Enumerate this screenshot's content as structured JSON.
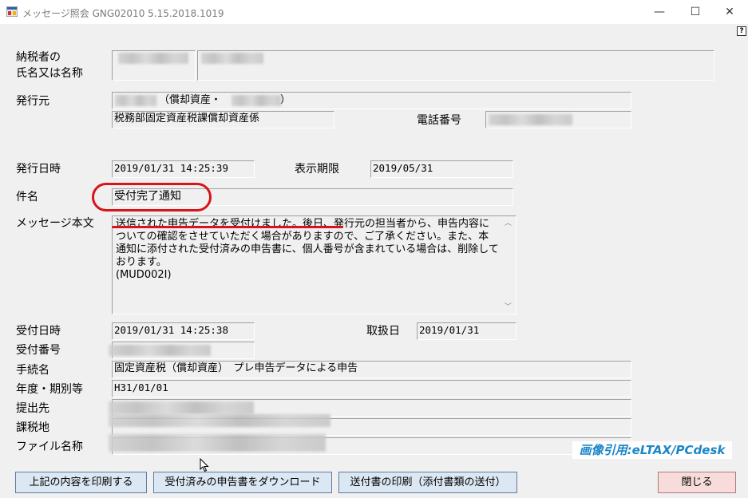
{
  "window": {
    "title": "メッセージ照会 GNG02010  5.15.2018.1019",
    "minimize": "—",
    "maximize": "☐",
    "close": "✕",
    "help": "?"
  },
  "labels": {
    "taxpayer_line1": "納税者の",
    "taxpayer_line2": "氏名又は名称",
    "issuer": "発行元",
    "phone": "電話番号",
    "issue_datetime": "発行日時",
    "display_deadline": "表示期限",
    "subject": "件名",
    "message_body": "メッセージ本文",
    "received_datetime": "受付日時",
    "handled_date": "取扱日",
    "received_number": "受付番号",
    "procedure_name": "手続名",
    "fiscal_period": "年度・期別等",
    "submit_to": "提出先",
    "tax_location": "課税地",
    "file_name": "ファイル名称"
  },
  "fields": {
    "issuer_name_suffix": "（償却資産・",
    "issuer_name_close": "）",
    "issuer_department": "税務部固定資産税課償却資産係",
    "issue_datetime": "2019/01/31 14:25:39",
    "display_deadline": "2019/05/31",
    "subject": "受付完了通知",
    "message_body": "送信された申告データを受付けました。後日、発行元の担当者から、申告内容についての確認をさせていただく場合がありますので、ご了承ください。また、本通知に添付された受付済みの申告書に、個人番号が含まれている場合は、削除しております。\n(MUD002I)",
    "received_datetime": "2019/01/31 14:25:38",
    "handled_date": "2019/01/31",
    "procedure_name": "固定資産税（償却資産）　プレ申告データによる申告",
    "fiscal_period": "H31/01/01"
  },
  "watermark": "画像引用:eLTAX/PCdesk",
  "buttons": {
    "print": "上記の内容を印刷する",
    "download": "受付済みの申告書をダウンロード",
    "print_cover": "送付書の印刷（添付書類の送付）",
    "close": "閉じる"
  }
}
